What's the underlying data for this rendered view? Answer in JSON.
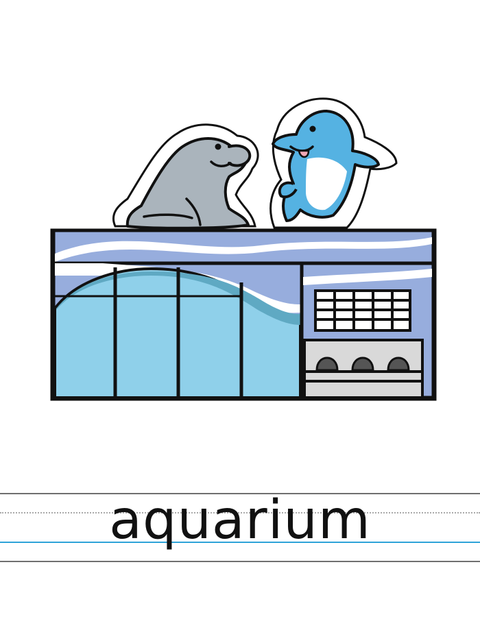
{
  "word": "aquarium",
  "colors": {
    "outline": "#111111",
    "glass": "#8fd0ea",
    "glass_dark": "#5fa9c3",
    "wall": "#97addd",
    "wave": "#ffffff",
    "seal": "#aab4bc",
    "dolphin": "#55b2e2",
    "gate": "#d9d9d9",
    "baseline": "#2ea3d8"
  },
  "icons": [
    "seal-icon",
    "dolphin-icon",
    "aquarium-building-icon"
  ]
}
